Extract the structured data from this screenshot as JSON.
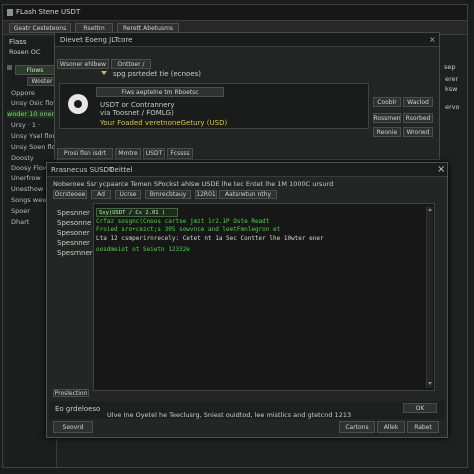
{
  "app": {
    "title": "FLash Stene USDT",
    "tabs": [
      "Geatr Cesteteons",
      "Rsettm",
      "Rerett Abetusms"
    ]
  },
  "sidebar": {
    "header": "Flass",
    "subheader": "Rosen OC",
    "tab_label": "Flows",
    "item_badge": "Woster",
    "items": [
      "Oppore",
      "Unsy Osic flow",
      "woder 10 oner",
      "Ursy · 1 ·",
      "Unsy Ysel flow",
      "Unsy Soen flow",
      "Doosty",
      "Doosy Flow",
      "Unerfrow",
      "Unesthow",
      "Songs wew",
      "Spoer",
      "Dhart"
    ]
  },
  "back_window": {
    "title": "Dievet Eoeng JLTcore",
    "tab_left": "Wsoner ehlbew",
    "tab_right": "Onttoer /",
    "info_line": "spg psrtedet tie (ecnoes)",
    "search_label": "Fiws aeptelne tm Rboetsc",
    "detail_line1": "USDT or Contrannery",
    "detail_line2": "via Toosnet / FOMLG)",
    "status_line": "Your Foaded veretnoneGetury (USD)",
    "btn_copy": "Cooblr",
    "btn_upload": "Waclod",
    "btn_a": "Rossmen",
    "btn_b": "Rsorbed",
    "btn_c": "Reonie",
    "btn_d": "Wrorwd",
    "bottom_tab1": "Prosi flsn isdrt",
    "bottom_tab2": "Mmtre",
    "bottom_tab3": "USDT",
    "bottom_tab4": "Fcssss",
    "right_label1": "sep",
    "right_label2": "erer",
    "right_label3": "ksw",
    "right_label4": "ervo"
  },
  "dialog": {
    "title_left": "Rrasnecus SUSDT",
    "title_right": "Oeittel",
    "close_glyph": "×",
    "header_line": "Noberoee  Ssr  ycpaarce  Temen  SPockst  ahlsw  USDE  lhe  tec  Entet  lhe  1M  1000C  ursurd",
    "tabs": [
      "Ocrsteoee",
      "Ad",
      "Ucrse",
      "Bmrecbtauy",
      "12R01",
      "Aatsrwtun  nthy"
    ],
    "side_labels": [
      "Spesnner",
      "Spesonne",
      "Spesoner",
      "Spesnner",
      "Spesrnner"
    ],
    "input_value": "Ssy(USDT / Cs 2.01 )",
    "console_lines": [
      "Crfaz sosgnc(Cnoos  cartse jmzt 1r2.1P  Oste Readt",
      "Froied  sro+cezct;s                       305  sowvnce  and  leetFmnlegron  et",
      "Lta  12  csmperirnrecely:  Cetet  nt  1a  Sec  Contter  lhe  10wter  ener",
      "",
      "oosdmeiot  ot  Seietn  12332e"
    ],
    "footer_label": "Proslection",
    "status_left": "Eo grdeloeso",
    "status_text": "Ulve Ine Oyetel he Teeclusrg, Sniest ouidtod, lee mistlics and gtetcnd  1213",
    "btn_ok": "OK",
    "btn_seevrd": "Seovrd",
    "btn_cartons": "Cartons",
    "btn_allek": "Allek",
    "btn_rabet": "Rabet"
  }
}
